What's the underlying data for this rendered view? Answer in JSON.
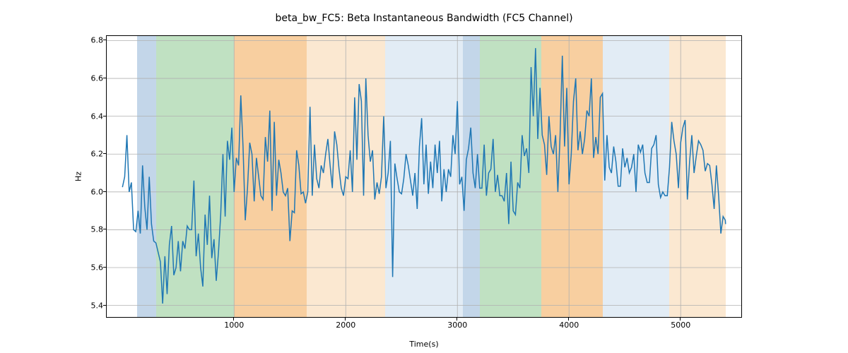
{
  "chart_data": {
    "type": "line",
    "title": "beta_bw_FC5: Beta Instantaneous Bandwidth (FC5 Channel)",
    "xlabel": "Time(s)",
    "ylabel": "Hz",
    "xlim": [
      -141.05,
      5543.05
    ],
    "ylim": [
      5.3388,
      6.8242
    ],
    "xticks": [
      1000,
      2000,
      3000,
      4000,
      5000
    ],
    "yticks": [
      5.4,
      5.6,
      5.8,
      6.0,
      6.2,
      6.4,
      6.6,
      6.8
    ],
    "bands": [
      {
        "start": 130,
        "end": 300,
        "color": "#c3d6e9"
      },
      {
        "start": 300,
        "end": 1000,
        "color": "#c0e1c2"
      },
      {
        "start": 1000,
        "end": 1650,
        "color": "#f8cfa0"
      },
      {
        "start": 1650,
        "end": 2350,
        "color": "#fbe8d1"
      },
      {
        "start": 2350,
        "end": 3050,
        "color": "#e2ecf5"
      },
      {
        "start": 3050,
        "end": 3200,
        "color": "#c3d6e9"
      },
      {
        "start": 3200,
        "end": 3750,
        "color": "#c0e1c2"
      },
      {
        "start": 3750,
        "end": 4300,
        "color": "#f8cfa0"
      },
      {
        "start": 4300,
        "end": 4900,
        "color": "#e2ecf5"
      },
      {
        "start": 4900,
        "end": 5402,
        "color": "#fbe8d1"
      }
    ],
    "x": [
      0,
      20,
      40,
      60,
      80,
      100,
      120,
      140,
      160,
      180,
      200,
      220,
      240,
      260,
      280,
      300,
      320,
      340,
      360,
      380,
      400,
      420,
      440,
      460,
      480,
      500,
      520,
      540,
      560,
      580,
      600,
      620,
      640,
      660,
      680,
      700,
      720,
      740,
      760,
      780,
      800,
      820,
      840,
      860,
      880,
      900,
      920,
      940,
      960,
      980,
      1000,
      1020,
      1040,
      1060,
      1080,
      1100,
      1120,
      1140,
      1160,
      1180,
      1200,
      1220,
      1240,
      1260,
      1280,
      1300,
      1320,
      1340,
      1360,
      1380,
      1400,
      1420,
      1440,
      1460,
      1480,
      1500,
      1520,
      1540,
      1560,
      1580,
      1600,
      1620,
      1640,
      1660,
      1680,
      1700,
      1720,
      1740,
      1760,
      1780,
      1800,
      1820,
      1840,
      1860,
      1880,
      1900,
      1920,
      1940,
      1960,
      1980,
      2000,
      2020,
      2040,
      2060,
      2080,
      2100,
      2120,
      2140,
      2160,
      2180,
      2200,
      2220,
      2240,
      2260,
      2280,
      2300,
      2320,
      2340,
      2360,
      2380,
      2400,
      2420,
      2440,
      2460,
      2480,
      2500,
      2520,
      2540,
      2560,
      2580,
      2600,
      2620,
      2640,
      2660,
      2680,
      2700,
      2720,
      2740,
      2760,
      2780,
      2800,
      2820,
      2840,
      2860,
      2880,
      2900,
      2920,
      2940,
      2960,
      2980,
      3000,
      3020,
      3040,
      3060,
      3080,
      3100,
      3120,
      3140,
      3160,
      3180,
      3200,
      3220,
      3240,
      3260,
      3280,
      3300,
      3320,
      3340,
      3360,
      3380,
      3400,
      3420,
      3440,
      3460,
      3480,
      3500,
      3520,
      3540,
      3560,
      3580,
      3600,
      3620,
      3640,
      3660,
      3680,
      3700,
      3720,
      3740,
      3760,
      3780,
      3800,
      3820,
      3840,
      3860,
      3880,
      3900,
      3920,
      3940,
      3960,
      3980,
      4000,
      4020,
      4040,
      4060,
      4080,
      4100,
      4120,
      4140,
      4160,
      4180,
      4200,
      4220,
      4240,
      4260,
      4280,
      4300,
      4320,
      4340,
      4360,
      4380,
      4400,
      4420,
      4440,
      4460,
      4480,
      4500,
      4520,
      4540,
      4560,
      4580,
      4600,
      4620,
      4640,
      4660,
      4680,
      4700,
      4720,
      4740,
      4760,
      4780,
      4800,
      4820,
      4840,
      4860,
      4880,
      4900,
      4920,
      4940,
      4960,
      4980,
      5000,
      5020,
      5040,
      5060,
      5080,
      5100,
      5120,
      5140,
      5160,
      5180,
      5200,
      5220,
      5240,
      5260,
      5280,
      5300,
      5320,
      5340,
      5360,
      5380,
      5400,
      5402
    ],
    "values": [
      6.025,
      6.08,
      6.3,
      6.0,
      6.05,
      5.8,
      5.79,
      5.9,
      5.78,
      6.14,
      5.92,
      5.8,
      6.08,
      5.83,
      5.74,
      5.73,
      5.68,
      5.63,
      5.41,
      5.66,
      5.46,
      5.72,
      5.82,
      5.56,
      5.6,
      5.74,
      5.58,
      5.74,
      5.7,
      5.82,
      5.8,
      5.8,
      6.06,
      5.66,
      5.78,
      5.6,
      5.5,
      5.88,
      5.72,
      5.98,
      5.65,
      5.75,
      5.53,
      5.68,
      5.88,
      6.2,
      5.87,
      6.27,
      6.17,
      6.34,
      6.0,
      6.18,
      6.14,
      6.51,
      6.24,
      5.85,
      6.02,
      6.26,
      6.2,
      5.95,
      6.18,
      6.08,
      5.98,
      5.96,
      6.29,
      6.16,
      6.43,
      5.9,
      6.37,
      5.98,
      6.17,
      6.1,
      6.0,
      5.98,
      6.02,
      5.74,
      5.9,
      5.89,
      6.22,
      6.14,
      5.99,
      6.0,
      5.94,
      6.0,
      6.45,
      5.98,
      6.25,
      6.07,
      6.02,
      6.14,
      6.1,
      6.2,
      6.28,
      6.14,
      6.02,
      6.32,
      6.25,
      6.12,
      6.02,
      5.98,
      6.08,
      6.07,
      6.22,
      6.0,
      6.5,
      6.17,
      6.57,
      6.48,
      5.98,
      6.6,
      6.3,
      6.16,
      6.22,
      5.96,
      6.05,
      5.99,
      6.08,
      6.4,
      6.02,
      6.1,
      6.27,
      5.55,
      6.15,
      6.07,
      6.0,
      5.99,
      6.07,
      6.2,
      6.14,
      6.06,
      5.98,
      6.1,
      5.91,
      6.24,
      6.39,
      6.04,
      6.25,
      5.99,
      6.16,
      6.02,
      6.25,
      6.1,
      6.27,
      5.95,
      6.12,
      6.0,
      6.12,
      6.08,
      6.3,
      6.2,
      6.48,
      6.04,
      6.08,
      5.9,
      6.17,
      6.23,
      6.34,
      6.1,
      6.02,
      6.2,
      6.02,
      6.02,
      6.25,
      5.98,
      6.1,
      6.12,
      6.28,
      6.0,
      6.09,
      5.98,
      5.98,
      5.95,
      6.1,
      5.83,
      6.16,
      5.9,
      5.88,
      6.05,
      6.02,
      6.3,
      6.19,
      6.23,
      6.1,
      6.66,
      6.4,
      6.76,
      6.28,
      6.55,
      6.3,
      6.25,
      6.09,
      6.4,
      6.24,
      6.2,
      6.3,
      6.0,
      6.3,
      6.72,
      6.24,
      6.55,
      6.04,
      6.2,
      6.48,
      6.6,
      6.22,
      6.32,
      6.2,
      6.28,
      6.43,
      6.4,
      6.6,
      6.18,
      6.29,
      6.2,
      6.5,
      6.52,
      6.06,
      6.3,
      6.13,
      6.1,
      6.24,
      6.16,
      6.03,
      6.03,
      6.23,
      6.13,
      6.18,
      6.1,
      6.13,
      6.2,
      6.0,
      6.25,
      6.21,
      6.25,
      6.1,
      6.05,
      6.05,
      6.23,
      6.25,
      6.3,
      6.04,
      5.97,
      6.0,
      5.98,
      5.98,
      6.13,
      6.37,
      6.27,
      6.2,
      6.02,
      6.26,
      6.34,
      6.38,
      5.96,
      6.16,
      6.3,
      6.1,
      6.19,
      6.27,
      6.25,
      6.22,
      6.11,
      6.15,
      6.14,
      6.04,
      5.91,
      6.14,
      5.98,
      5.78,
      5.87,
      5.85,
      5.83
    ]
  }
}
